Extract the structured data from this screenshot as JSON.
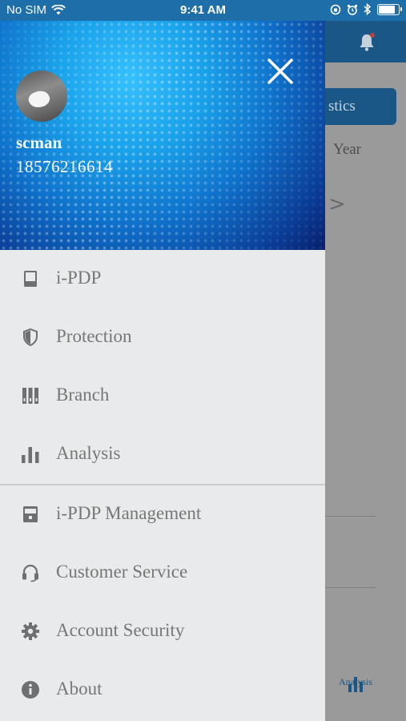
{
  "status_bar": {
    "carrier": "No SIM",
    "time": "9:41 AM"
  },
  "background": {
    "tab_label": "stics",
    "year_label": "Year",
    "chevron": ">",
    "bottom_tab_label": "Analysis"
  },
  "drawer": {
    "user": {
      "name": "scman",
      "phone": "18576216614"
    },
    "menu_group_1": [
      {
        "label": "i-PDP",
        "icon": "device-icon"
      },
      {
        "label": "Protection",
        "icon": "shield-icon"
      },
      {
        "label": "Branch",
        "icon": "branch-icon"
      },
      {
        "label": "Analysis",
        "icon": "bar-chart-icon"
      }
    ],
    "menu_group_2": [
      {
        "label": "i-PDP Management",
        "icon": "device-management-icon"
      },
      {
        "label": "Customer Service",
        "icon": "headset-icon"
      },
      {
        "label": "Account Security",
        "icon": "gear-icon"
      },
      {
        "label": "About",
        "icon": "info-icon"
      }
    ]
  },
  "colors": {
    "header_blue": "#1a5786",
    "drawer_bg": "#e9eaeb",
    "menu_text": "#777777",
    "icon_gray": "#6e6f70"
  }
}
